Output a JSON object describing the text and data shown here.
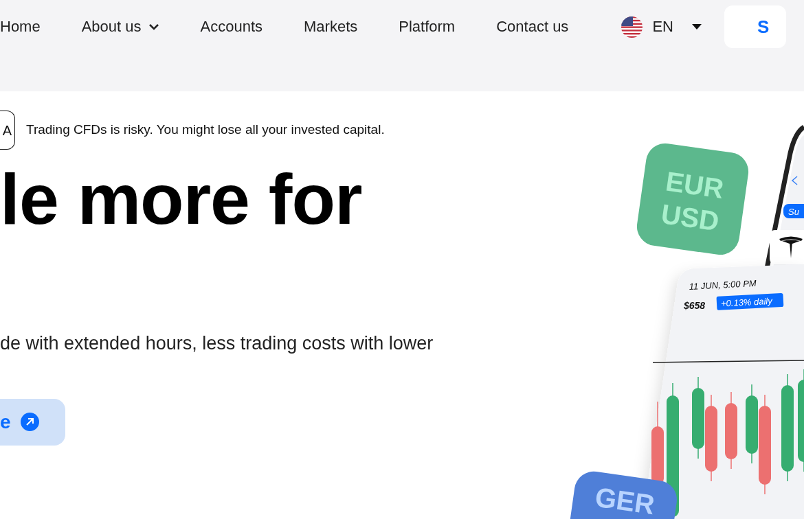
{
  "nav": {
    "items": [
      {
        "label": "Home",
        "has_dropdown": false
      },
      {
        "label": "About us",
        "has_dropdown": true
      },
      {
        "label": "Accounts",
        "has_dropdown": false
      },
      {
        "label": "Markets",
        "has_dropdown": false
      },
      {
        "label": "Platform",
        "has_dropdown": false
      },
      {
        "label": "Contact us",
        "has_dropdown": false
      }
    ],
    "language": {
      "label": "EN"
    },
    "signup_button": {
      "label": "S"
    }
  },
  "hero": {
    "badge": "A",
    "risk_warning": "Trading CFDs is risky. You might lose all your invested capital.",
    "headline": "le more for",
    "description": "de with extended hours, less trading costs with lower",
    "cta_button": {
      "label": "e"
    }
  },
  "illustration": {
    "tile_top": [
      "EUR",
      "USD"
    ],
    "ticker_pill": "Su",
    "date": "11 JUN, 5:00 PM",
    "price": "$658",
    "change": "+0.13% daily",
    "tile_bottom": [
      "GER"
    ]
  }
}
